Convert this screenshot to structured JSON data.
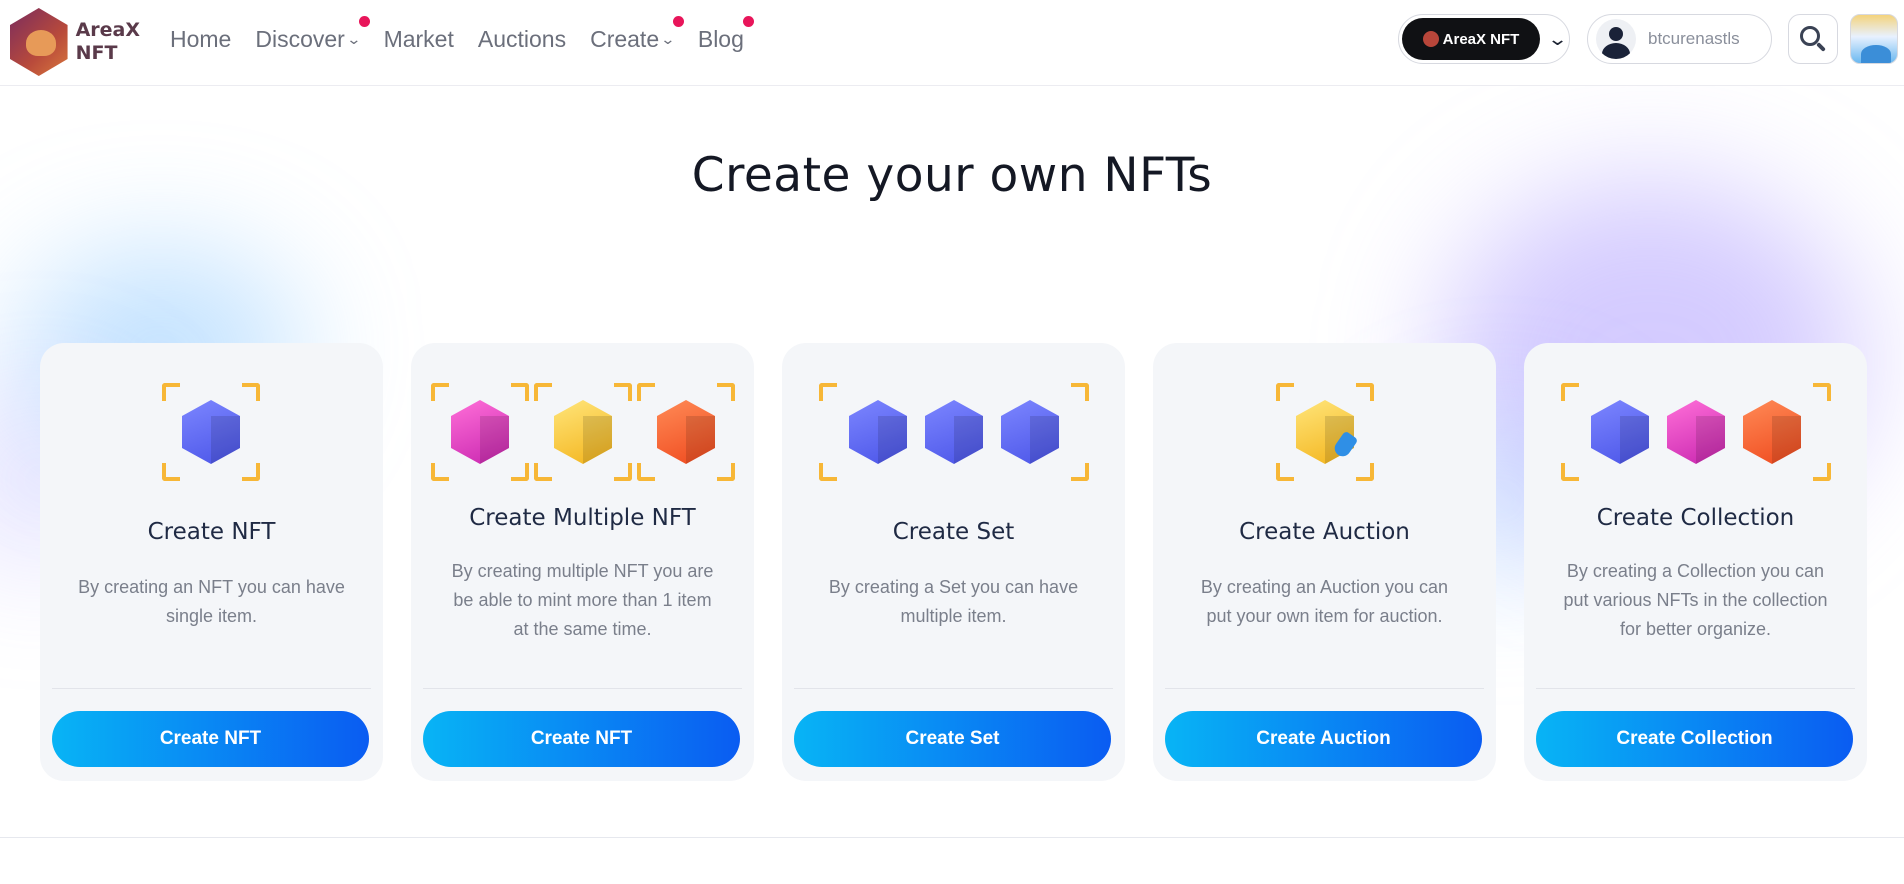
{
  "brand": {
    "name_line1": "AreaX",
    "name_line2": "NFT"
  },
  "nav": {
    "items": [
      {
        "label": "Home",
        "has_dropdown": false,
        "has_dot": false
      },
      {
        "label": "Discover",
        "has_dropdown": true,
        "has_dot": true
      },
      {
        "label": "Market",
        "has_dropdown": false,
        "has_dot": false
      },
      {
        "label": "Auctions",
        "has_dropdown": false,
        "has_dot": false
      },
      {
        "label": "Create",
        "has_dropdown": true,
        "has_dot": true
      },
      {
        "label": "Blog",
        "has_dropdown": false,
        "has_dot": true
      }
    ],
    "dot_color": "#e8155a"
  },
  "header_right": {
    "network_label": "AreaX NFT",
    "username": "btcurenastls"
  },
  "page": {
    "title": "Create your own NFTs"
  },
  "cards": [
    {
      "title": "Create NFT",
      "description": "By creating an NFT you can have single item.",
      "button_label": "Create NFT",
      "icon": "single-cube-icon"
    },
    {
      "title": "Create Multiple NFT",
      "description": "By creating multiple NFT you are be able to mint more than 1 item at the same time.",
      "button_label": "Create NFT",
      "icon": "multiple-cubes-icon"
    },
    {
      "title": "Create Set",
      "description": "By creating a Set you can have multiple item.",
      "button_label": "Create Set",
      "icon": "set-cubes-icon"
    },
    {
      "title": "Create Auction",
      "description": "By creating an Auction you can put your own item for auction.",
      "button_label": "Create Auction",
      "icon": "auction-cube-icon"
    },
    {
      "title": "Create Collection",
      "description": "By creating a Collection you can put various NFTs in the collection for better organize.",
      "button_label": "Create Collection",
      "icon": "collection-cubes-icon"
    }
  ],
  "colors": {
    "accent_gradient_start": "#08b4f5",
    "accent_gradient_end": "#0a5cf2",
    "bracket": "#f7b737",
    "cube_blue": "#5f68f5",
    "cube_pink": "#e340c4",
    "cube_yellow": "#fbcf3f",
    "cube_orange": "#f5602e"
  }
}
